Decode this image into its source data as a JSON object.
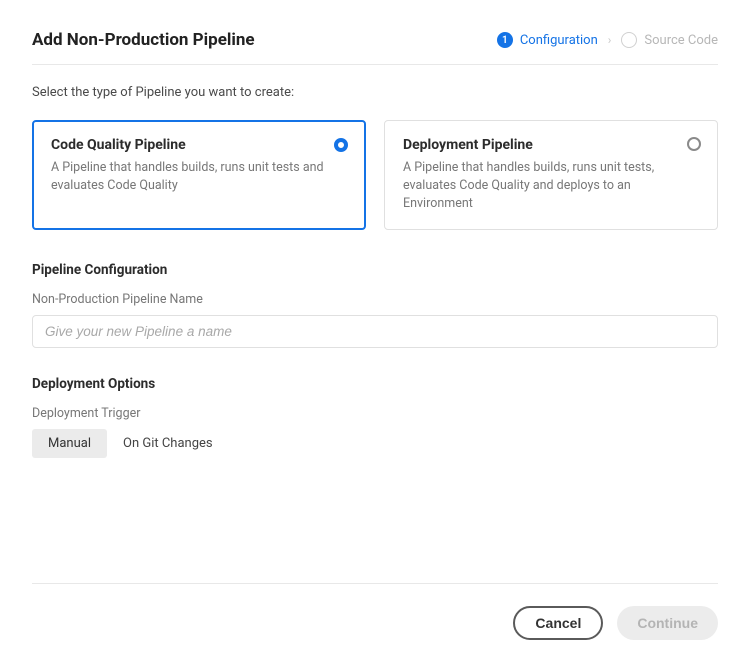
{
  "header": {
    "title": "Add Non-Production Pipeline"
  },
  "stepper": {
    "steps": [
      {
        "num": "1",
        "label": "Configuration",
        "active": true
      },
      {
        "num": "",
        "label": "Source Code",
        "active": false
      }
    ]
  },
  "intro": "Select the type of Pipeline you want to create:",
  "pipelineTypes": {
    "options": [
      {
        "title": "Code Quality Pipeline",
        "desc": "A Pipeline that handles builds, runs unit tests and evaluates Code Quality",
        "selected": true
      },
      {
        "title": "Deployment Pipeline",
        "desc": "A Pipeline that handles builds, runs unit tests, evaluates Code Quality and deploys to an Environment",
        "selected": false
      }
    ]
  },
  "config": {
    "sectionTitle": "Pipeline Configuration",
    "nameLabel": "Non-Production Pipeline Name",
    "namePlaceholder": "Give your new Pipeline a name",
    "nameValue": ""
  },
  "deployment": {
    "sectionTitle": "Deployment Options",
    "triggerLabel": "Deployment Trigger",
    "options": [
      {
        "label": "Manual",
        "selected": true
      },
      {
        "label": "On Git Changes",
        "selected": false
      }
    ]
  },
  "footer": {
    "cancel": "Cancel",
    "continue": "Continue"
  }
}
